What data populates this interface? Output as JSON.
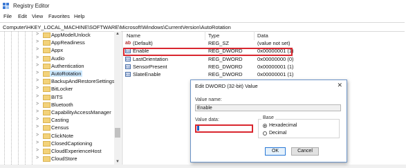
{
  "window": {
    "title": "Registry Editor",
    "icon": "registry-editor-icon"
  },
  "menu": [
    "File",
    "Edit",
    "View",
    "Favorites",
    "Help"
  ],
  "address": "Computer\\HKEY_LOCAL_MACHINE\\SOFTWARE\\Microsoft\\Windows\\CurrentVersion\\AutoRotation",
  "tree": {
    "items": [
      {
        "label": "AppModelUnlock"
      },
      {
        "label": "AppReadiness"
      },
      {
        "label": "Appx"
      },
      {
        "label": "Audio"
      },
      {
        "label": "Authentication"
      },
      {
        "label": "AutoRotation",
        "selected": true
      },
      {
        "label": "BackupAndRestoreSettings"
      },
      {
        "label": "BitLocker"
      },
      {
        "label": "BITS"
      },
      {
        "label": "Bluetooth"
      },
      {
        "label": "CapabilityAccessManager"
      },
      {
        "label": "Casting"
      },
      {
        "label": "Census"
      },
      {
        "label": "ClickNote"
      },
      {
        "label": "ClosedCaptioning"
      },
      {
        "label": "CloudExperienceHost"
      },
      {
        "label": "CloudStore"
      }
    ]
  },
  "values": {
    "columns": {
      "name": "Name",
      "type": "Type",
      "data": "Data"
    },
    "rows": [
      {
        "name": "(Default)",
        "type": "REG_SZ",
        "data": "(value not set)",
        "icon": "string-value-icon"
      },
      {
        "name": "Enable",
        "type": "REG_DWORD",
        "data": "0x00000001 (1)",
        "icon": "dword-value-icon",
        "highlighted": true
      },
      {
        "name": "LastOrientation",
        "type": "REG_DWORD",
        "data": "0x00000000 (0)",
        "icon": "dword-value-icon"
      },
      {
        "name": "SensorPresent",
        "type": "REG_DWORD",
        "data": "0x00000001 (1)",
        "icon": "dword-value-icon"
      },
      {
        "name": "SlateEnable",
        "type": "REG_DWORD",
        "data": "0x00000001 (1)",
        "icon": "dword-value-icon"
      }
    ]
  },
  "dialog": {
    "title": "Edit DWORD (32-bit) Value",
    "close_glyph": "✕",
    "value_name_label": "Value name:",
    "value_name": "Enable",
    "value_data_label": "Value data:",
    "value_data": "",
    "base_label": "Base",
    "radio_hex": "Hexadecimal",
    "radio_dec": "Decimal",
    "selected_base": "Hexadecimal",
    "ok": "OK",
    "cancel": "Cancel"
  },
  "colors": {
    "highlight": "#d9262e",
    "folder": "#f3d27a",
    "selection": "#cce8ff"
  }
}
